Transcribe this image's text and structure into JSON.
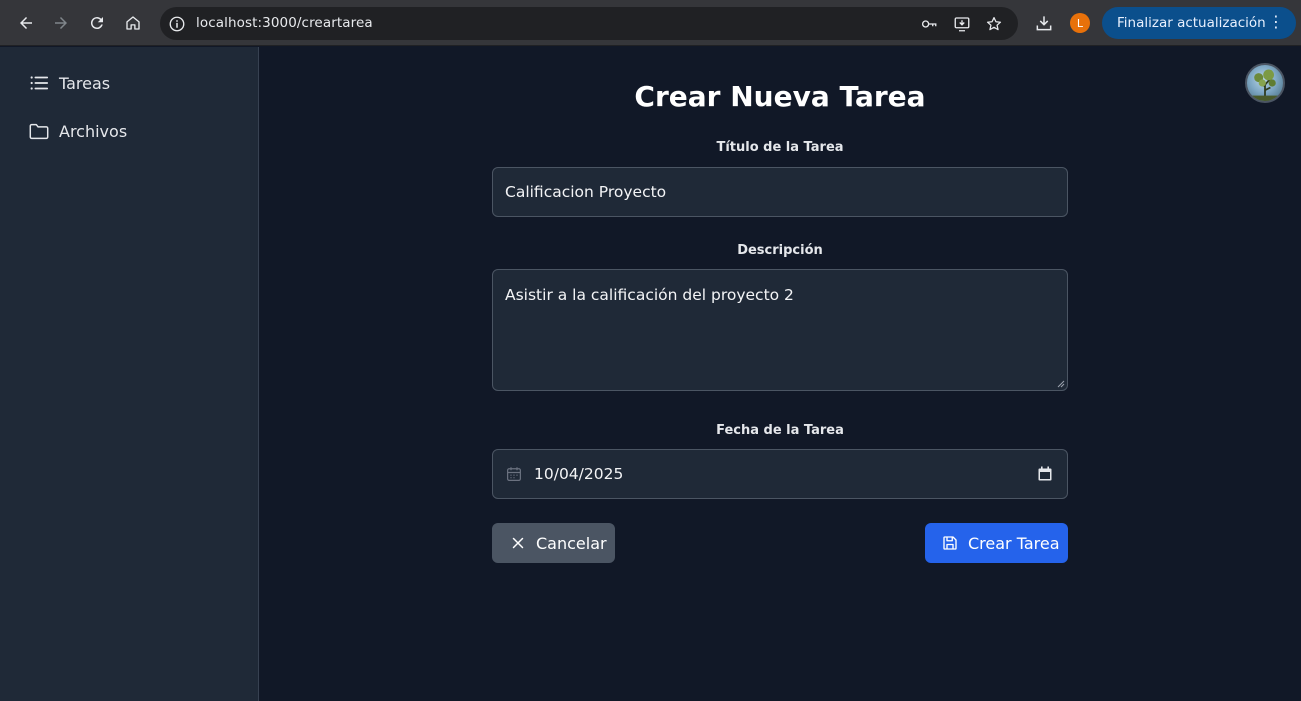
{
  "browser": {
    "url": "localhost:3000/creartarea",
    "profile_initial": "L",
    "update_label": "Finalizar actualización",
    "menu_glyph": "⋮",
    "profile_color": "#e8710a",
    "update_color": "#0b4f8c"
  },
  "sidebar": {
    "items": [
      {
        "label": "Tareas",
        "icon": "list-icon"
      },
      {
        "label": "Archivos",
        "icon": "folder-icon"
      }
    ]
  },
  "form": {
    "heading": "Crear Nueva Tarea",
    "title_label": "Título de la Tarea",
    "title_value": "Calificacion Proyecto",
    "description_label": "Descripción",
    "description_value": "Asistir a la calificación del proyecto 2",
    "date_label": "Fecha de la Tarea",
    "date_value": "10/04/2025",
    "cancel_label": "Cancelar",
    "create_label": "Crear Tarea"
  },
  "colors": {
    "page_bg": "#111827",
    "sidebar_bg": "#1f2937",
    "primary": "#2563eb",
    "secondary": "#4b5563"
  }
}
